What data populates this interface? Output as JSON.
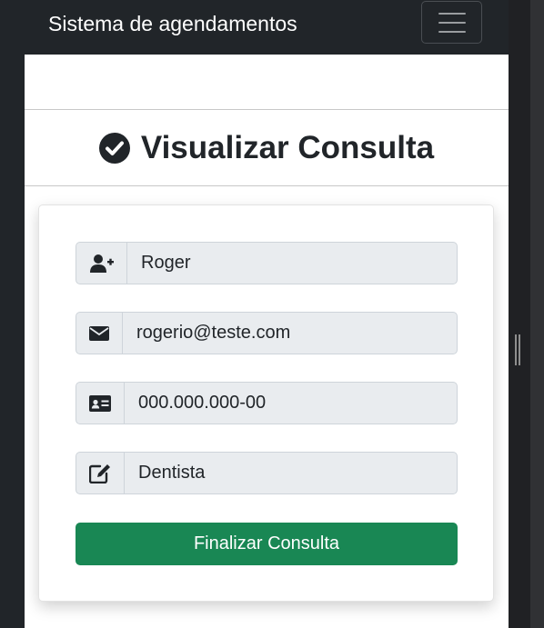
{
  "navbar": {
    "brand": "Sistema de agendamentos"
  },
  "page": {
    "title": "Visualizar Consulta",
    "title_icon": "check-circle-icon"
  },
  "form": {
    "fields": [
      {
        "icon": "user-plus-icon",
        "value": "Roger"
      },
      {
        "icon": "envelope-icon",
        "value": "rogerio@teste.com"
      },
      {
        "icon": "id-card-icon",
        "value": "000.000.000-00"
      },
      {
        "icon": "edit-icon",
        "value": "Dentista"
      }
    ],
    "submit_label": "Finalizar Consulta"
  },
  "colors": {
    "navbar_bg": "#212529",
    "submit_bg": "#198754",
    "field_bg": "#e9ecef"
  }
}
